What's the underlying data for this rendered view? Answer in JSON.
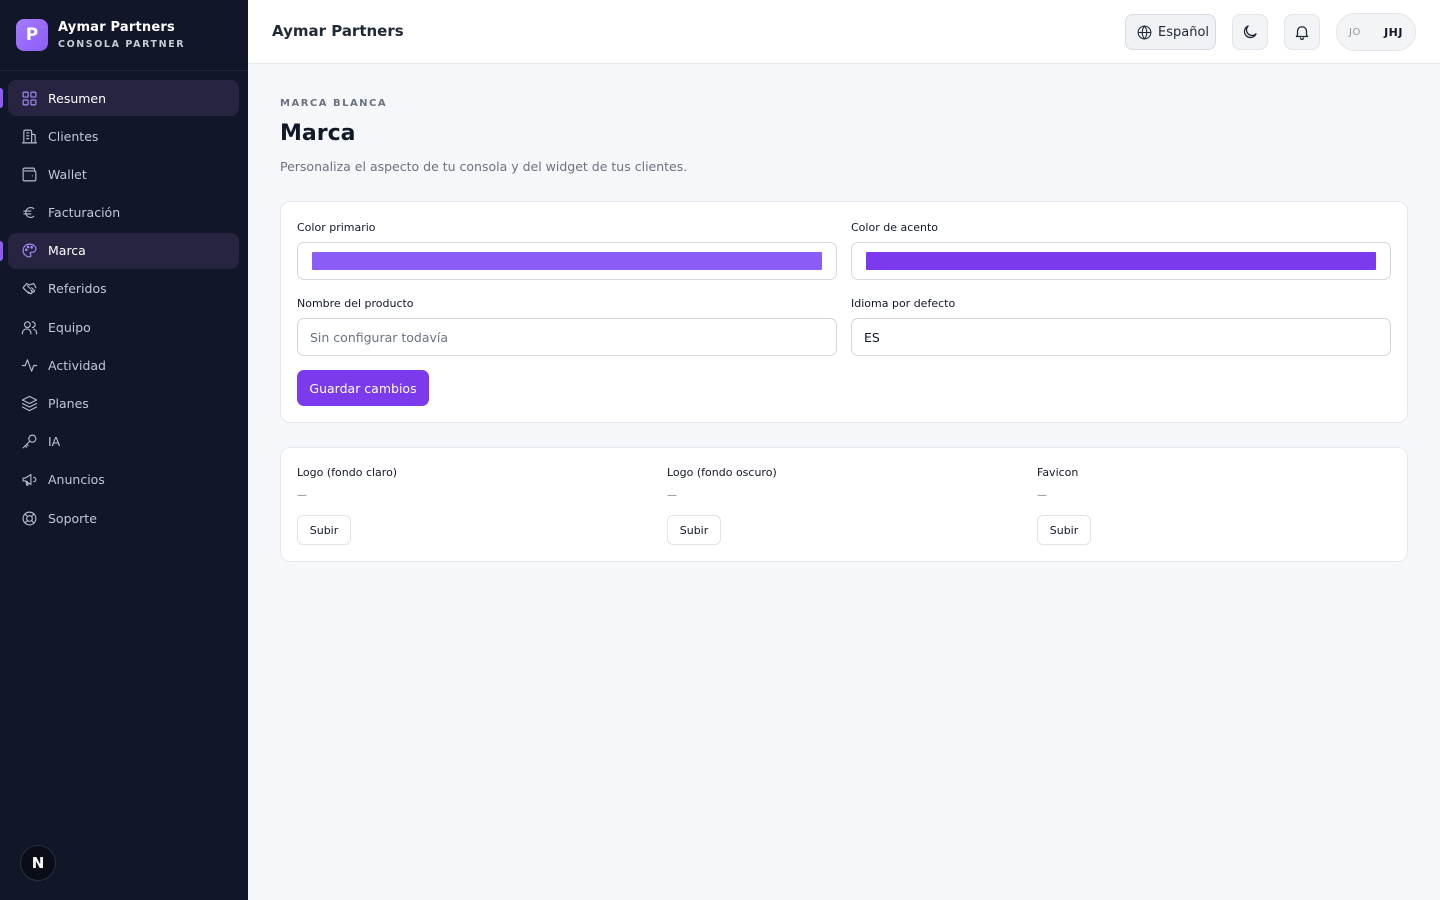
{
  "brand": {
    "initial": "P",
    "name": "Aymar Partners",
    "subtitle": "CONSOLA PARTNER"
  },
  "sidebar": {
    "items": [
      {
        "label": "Resumen",
        "icon": "grid-icon",
        "active": true
      },
      {
        "label": "Clientes",
        "icon": "building-icon",
        "active": false
      },
      {
        "label": "Wallet",
        "icon": "wallet-icon",
        "active": false
      },
      {
        "label": "Facturación",
        "icon": "euro-icon",
        "active": false
      },
      {
        "label": "Marca",
        "icon": "palette-icon",
        "active": true
      },
      {
        "label": "Referidos",
        "icon": "handshake-icon",
        "active": false
      },
      {
        "label": "Equipo",
        "icon": "users-icon",
        "active": false
      },
      {
        "label": "Actividad",
        "icon": "activity-icon",
        "active": false
      },
      {
        "label": "Planes",
        "icon": "layers-icon",
        "active": false
      },
      {
        "label": "IA",
        "icon": "key-icon",
        "active": false
      },
      {
        "label": "Anuncios",
        "icon": "megaphone-icon",
        "active": false
      },
      {
        "label": "Soporte",
        "icon": "lifebuoy-icon",
        "active": false
      }
    ],
    "bottom_badge": "N"
  },
  "header": {
    "title": "Aymar Partners",
    "language": "Español",
    "user_avatar": "JO",
    "user_initials": "JHJ"
  },
  "page": {
    "eyebrow": "MARCA BLANCA",
    "title": "Marca",
    "description": "Personaliza el aspecto de tu consola y del widget de tus clientes."
  },
  "form": {
    "primary_color_label": "Color primario",
    "primary_color": "#8b5cf6",
    "accent_color_label": "Color de acento",
    "accent_color": "#7c3aed",
    "product_name_label": "Nombre del producto",
    "product_name_placeholder": "Sin configurar todavía",
    "product_name_value": "",
    "default_language_label": "Idioma por defecto",
    "default_language_value": "ES",
    "save_label": "Guardar cambios"
  },
  "logos": [
    {
      "label": "Logo (fondo claro)",
      "value": "—",
      "upload_label": "Subir"
    },
    {
      "label": "Logo (fondo oscuro)",
      "value": "—",
      "upload_label": "Subir"
    },
    {
      "label": "Favicon",
      "value": "—",
      "upload_label": "Subir"
    }
  ]
}
